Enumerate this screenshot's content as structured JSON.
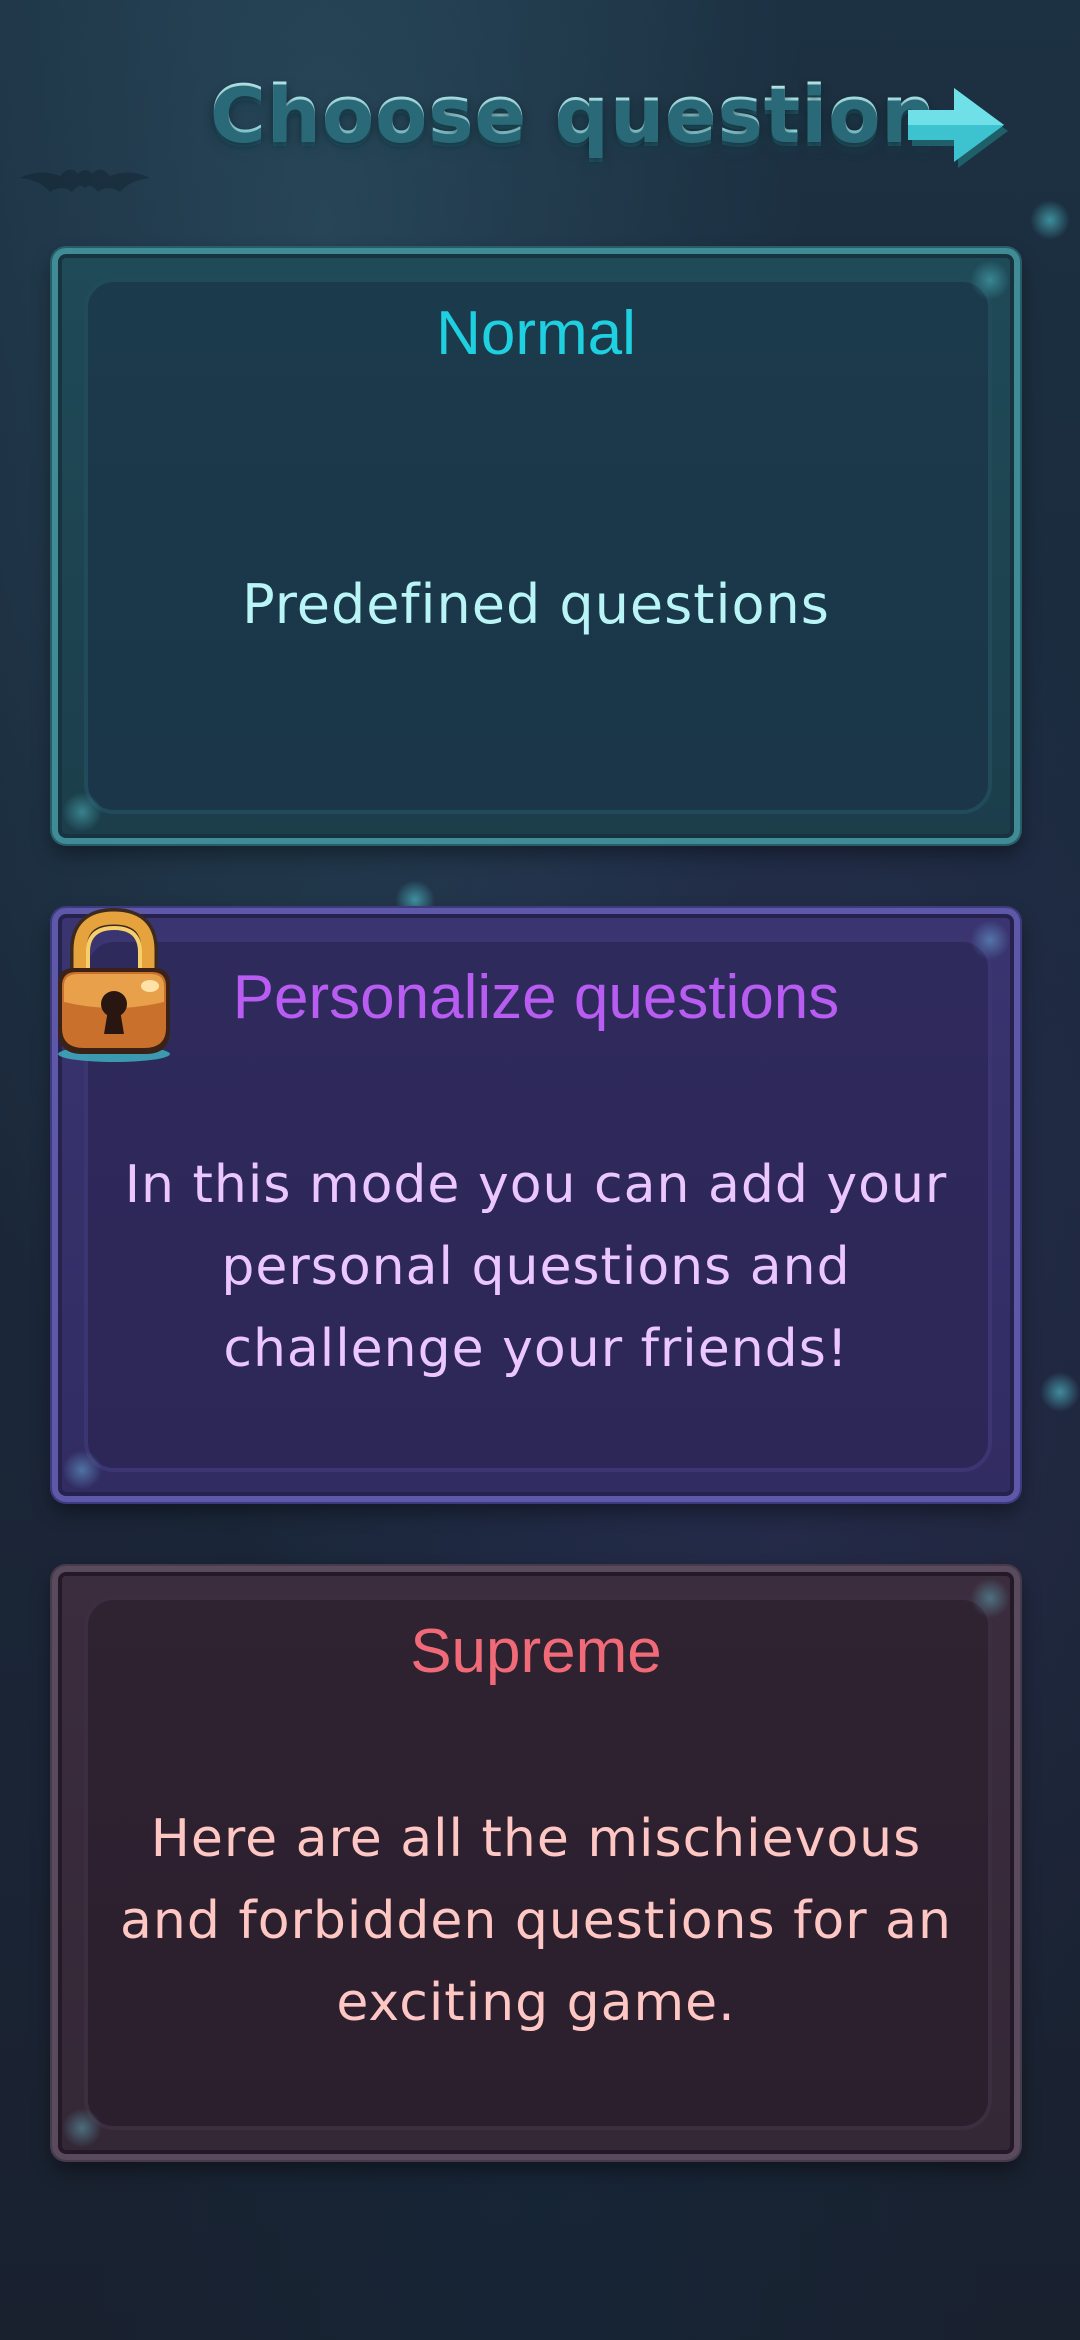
{
  "header": {
    "title": "Choose question",
    "next_icon": "arrow-right-icon"
  },
  "modes": {
    "normal": {
      "title": "Normal",
      "description": "Predefined questions",
      "locked": false,
      "accent": "#1ed0e0"
    },
    "personalize": {
      "title": "Personalize questions",
      "description": "In this mode you can add your personal questions and challenge your friends!",
      "locked": true,
      "lock_icon": "padlock-icon",
      "accent": "#b85cf2"
    },
    "supreme": {
      "title": "Supreme",
      "description": "Here are all the mischievous and forbidden questions for an exciting game.",
      "locked": false,
      "accent": "#f06a78"
    }
  }
}
